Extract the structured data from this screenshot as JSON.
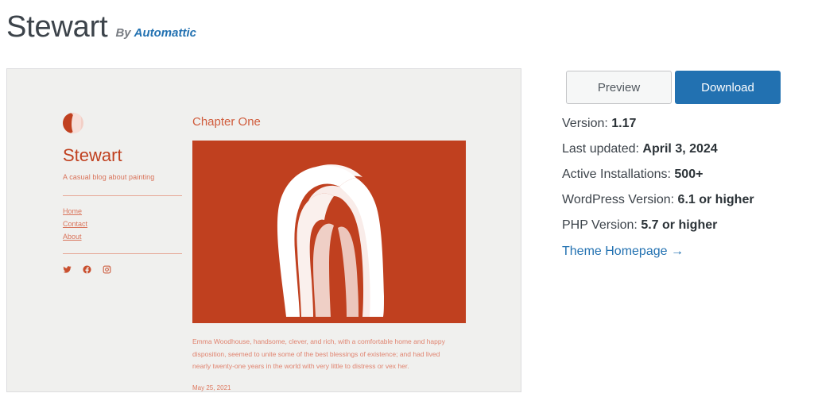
{
  "header": {
    "title": "Stewart",
    "by_label": "By",
    "author": "Automattic"
  },
  "actions": {
    "preview_label": "Preview",
    "download_label": "Download"
  },
  "meta": [
    {
      "label": "Version:",
      "value": "1.17"
    },
    {
      "label": "Last updated:",
      "value": "April 3, 2024"
    },
    {
      "label": "Active Installations:",
      "value": "500+"
    },
    {
      "label": "WordPress Version:",
      "value": "6.1 or higher"
    },
    {
      "label": "PHP Version:",
      "value": "5.7 or higher"
    }
  ],
  "homepage_link": "Theme Homepage  →",
  "preview": {
    "site_name": "Stewart",
    "tagline": "A casual blog about painting",
    "nav": [
      {
        "label": "Home"
      },
      {
        "label": "Contact"
      },
      {
        "label": "About"
      }
    ],
    "social": [
      {
        "name": "twitter-icon"
      },
      {
        "name": "facebook-icon"
      },
      {
        "name": "instagram-icon"
      }
    ],
    "post": {
      "title": "Chapter One",
      "excerpt": "Emma Woodhouse, handsome, clever, and rich, with a comfortable home and happy disposition, seemed to unite some of the best blessings of existence; and had lived nearly twenty-one years in the world with very little to distress or vex her.",
      "date": "May 25, 2021"
    }
  },
  "colors": {
    "accent": "#c0401f",
    "accent_light": "#e08470",
    "link": "#2271b1",
    "card_bg": "#f0f0ee"
  }
}
